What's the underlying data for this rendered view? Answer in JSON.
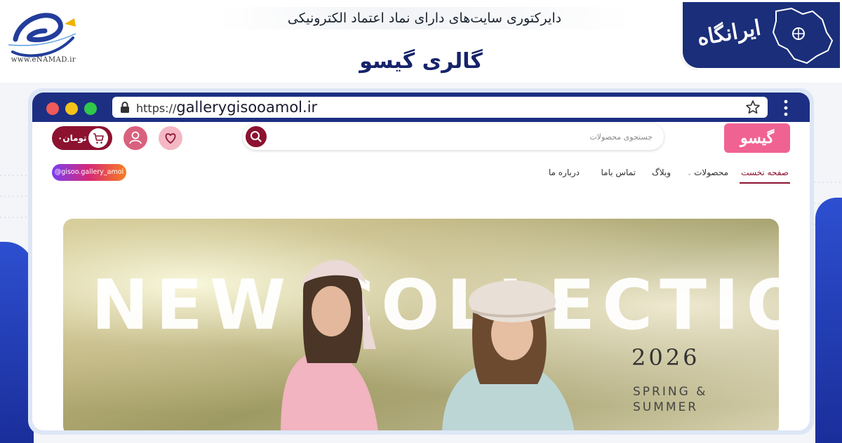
{
  "header": {
    "enamad_url": "www.eNAMAD.ir",
    "directory_title": "دایرکتوری سایت‌های دارای نماد اعتماد الکترونیکی",
    "site_name": "گالری گیسو",
    "irangah_label": "ایرانگاه"
  },
  "browser": {
    "url_scheme": "https://",
    "url_host": "gallerygisooamol.ir"
  },
  "site": {
    "logo_text": "گیسو",
    "cart_label": "تومان۰",
    "search_placeholder": "جستجوی محصولات",
    "instagram_handle": "@gisoo.gallery_amol",
    "nav": {
      "home": "صفحه نخست",
      "products": "محصولات",
      "blog": "وبلاگ",
      "contact": "تماس باما",
      "about": "درباره ما"
    }
  },
  "hero": {
    "headline": "NEW COLLECTION",
    "year": "2026",
    "season_line1": "SPRING &",
    "season_line2": "SUMMER"
  },
  "colors": {
    "brand_maroon": "#8c1230",
    "brand_pink": "#f06292",
    "browser_bar": "#1c2f82",
    "site_title_blue": "#16236b"
  },
  "icons": [
    "lock-icon",
    "star-icon",
    "kebab-menu-icon",
    "search-icon",
    "cart-icon",
    "user-icon",
    "heart-icon"
  ]
}
